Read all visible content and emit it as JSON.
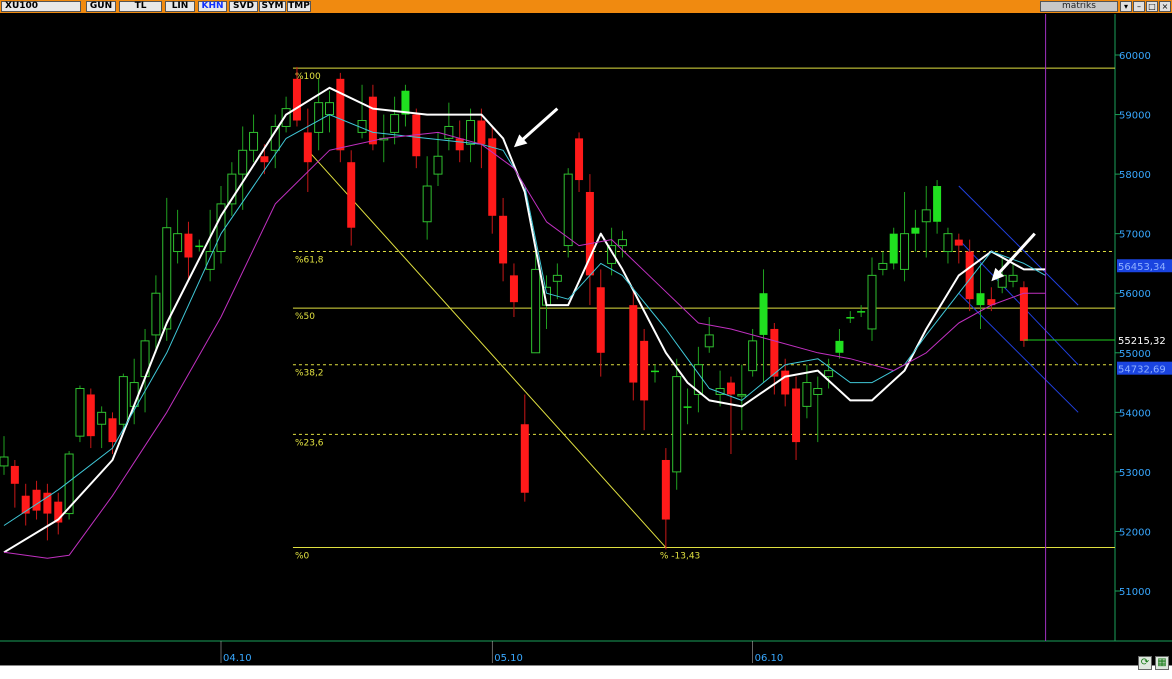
{
  "toolbar": {
    "symbol": "XU100",
    "buttons": [
      "GUN",
      "TL",
      "LIN",
      "KHN",
      "SVD",
      "SYM",
      "TMP"
    ],
    "active": "KHN",
    "brand": "matriks"
  },
  "colors": {
    "background": "#000000",
    "up_candle": "#20e020",
    "down_candle": "#ff1a1a",
    "hollow_candle": "#30c030",
    "ma_fast": "#ffffff",
    "ma_mid": "#40c8d8",
    "ma_slow": "#c030c0",
    "fibonacci": "#e0e040",
    "channel": "#2040e0",
    "axis_text": "#38a8ff",
    "price_tag": "#1a44e0"
  },
  "chart_data": {
    "type": "candlestick",
    "title": "XU100",
    "xlabel": "",
    "ylabel": "",
    "ylim": [
      50000,
      60800
    ],
    "y_ticks": [
      "60000",
      "59000",
      "58000",
      "57000",
      "56000",
      "55000",
      "54000",
      "53000",
      "52000",
      "51000"
    ],
    "x_ticks": [
      "04.10",
      "05.10",
      "06.10"
    ],
    "x_tick_index": [
      20,
      45,
      69
    ],
    "price_tags": [
      {
        "label": "56453,34",
        "value": 56453
      },
      {
        "label": "55215,32",
        "value": 55215
      },
      {
        "label": "54732,69",
        "value": 54733
      }
    ],
    "candles": [
      [
        53250,
        53100,
        53600,
        52950,
        "hollow"
      ],
      [
        53100,
        52800,
        53200,
        52400,
        "down"
      ],
      [
        52600,
        52300,
        52800,
        52100,
        "down"
      ],
      [
        52700,
        52350,
        52850,
        52200,
        "down"
      ],
      [
        52650,
        52300,
        52800,
        51850,
        "down"
      ],
      [
        52500,
        52150,
        52650,
        51950,
        "down"
      ],
      [
        52300,
        53300,
        53350,
        52200,
        "hollow"
      ],
      [
        53600,
        54400,
        54450,
        53500,
        "hollow"
      ],
      [
        54300,
        53600,
        54400,
        53400,
        "down"
      ],
      [
        53800,
        54000,
        54100,
        53400,
        "hollow"
      ],
      [
        53900,
        53500,
        54000,
        53300,
        "down"
      ],
      [
        53800,
        54600,
        54650,
        53700,
        "hollow"
      ],
      [
        54100,
        54500,
        54900,
        53800,
        "hollow"
      ],
      [
        54600,
        55200,
        55400,
        54000,
        "hollow"
      ],
      [
        55300,
        56000,
        56300,
        55000,
        "hollow"
      ],
      [
        55400,
        57100,
        57600,
        55200,
        "hollow"
      ],
      [
        56700,
        57000,
        57400,
        56500,
        "hollow"
      ],
      [
        57000,
        56600,
        57200,
        56200,
        "down"
      ],
      [
        56800,
        56800,
        56900,
        56700,
        "up"
      ],
      [
        56400,
        56700,
        57400,
        56200,
        "hollow"
      ],
      [
        56700,
        57500,
        57800,
        56500,
        "hollow"
      ],
      [
        57500,
        58000,
        58200,
        57300,
        "hollow"
      ],
      [
        58000,
        58400,
        58800,
        57400,
        "hollow"
      ],
      [
        58400,
        58700,
        59000,
        58200,
        "hollow"
      ],
      [
        58300,
        58200,
        58500,
        58000,
        "down"
      ],
      [
        58400,
        58800,
        59000,
        58100,
        "hollow"
      ],
      [
        58800,
        59100,
        59300,
        58700,
        "hollow"
      ],
      [
        59600,
        58900,
        59800,
        58800,
        "down"
      ],
      [
        58700,
        58200,
        59100,
        57700,
        "down"
      ],
      [
        58700,
        59200,
        59600,
        58400,
        "hollow"
      ],
      [
        59000,
        59200,
        59400,
        58700,
        "hollow"
      ],
      [
        59600,
        58400,
        59700,
        58200,
        "down"
      ],
      [
        58200,
        57100,
        58400,
        56800,
        "down"
      ],
      [
        58700,
        58900,
        59500,
        58600,
        "hollow"
      ],
      [
        59300,
        58500,
        59500,
        58400,
        "down"
      ],
      [
        58600,
        58600,
        59000,
        58200,
        "hollow"
      ],
      [
        58700,
        59000,
        59300,
        58500,
        "hollow"
      ],
      [
        59400,
        59000,
        59500,
        58800,
        "up"
      ],
      [
        59000,
        58300,
        59100,
        58100,
        "down"
      ],
      [
        57200,
        57800,
        58300,
        56900,
        "hollow"
      ],
      [
        58000,
        58300,
        58700,
        57800,
        "hollow"
      ],
      [
        58800,
        58600,
        59200,
        58400,
        "hollow"
      ],
      [
        58600,
        58400,
        58900,
        58200,
        "down"
      ],
      [
        58500,
        58900,
        59100,
        58200,
        "hollow"
      ],
      [
        58900,
        58500,
        59100,
        58100,
        "down"
      ],
      [
        58600,
        57300,
        58800,
        57000,
        "down"
      ],
      [
        57300,
        56500,
        57600,
        56200,
        "down"
      ],
      [
        56300,
        55850,
        56500,
        55600,
        "down"
      ],
      [
        53800,
        52650,
        54300,
        52500,
        "down"
      ],
      [
        55000,
        56400,
        56800,
        55000,
        "hollow"
      ],
      [
        55800,
        56100,
        56300,
        55400,
        "hollow"
      ],
      [
        56200,
        56300,
        56500,
        55900,
        "hollow"
      ],
      [
        56800,
        58000,
        58100,
        56600,
        "hollow"
      ],
      [
        58600,
        57900,
        58700,
        57700,
        "down"
      ],
      [
        57700,
        56300,
        58000,
        55800,
        "down"
      ],
      [
        56100,
        55000,
        56400,
        54600,
        "down"
      ],
      [
        56800,
        56500,
        57100,
        56300,
        "hollow"
      ],
      [
        56800,
        56900,
        57050,
        56600,
        "hollow"
      ],
      [
        55800,
        54500,
        56100,
        54200,
        "down"
      ],
      [
        55200,
        54200,
        55400,
        53700,
        "down"
      ],
      [
        54700,
        54700,
        54800,
        54500,
        "up"
      ],
      [
        53200,
        52200,
        53400,
        51700,
        "down"
      ],
      [
        53000,
        54600,
        54900,
        52700,
        "hollow"
      ],
      [
        54100,
        54100,
        54400,
        53800,
        "up"
      ],
      [
        54300,
        54800,
        55100,
        54000,
        "hollow"
      ],
      [
        55100,
        55300,
        55600,
        55000,
        "hollow"
      ],
      [
        54300,
        54400,
        54700,
        54100,
        "hollow"
      ],
      [
        54500,
        54300,
        54600,
        53300,
        "down"
      ],
      [
        54300,
        54300,
        54800,
        53700,
        "hollow"
      ],
      [
        54700,
        55200,
        55400,
        54600,
        "hollow"
      ],
      [
        55300,
        56000,
        56400,
        54500,
        "up"
      ],
      [
        55400,
        54600,
        55500,
        54300,
        "down"
      ],
      [
        54700,
        54300,
        54900,
        54100,
        "down"
      ],
      [
        54400,
        53500,
        54600,
        53200,
        "down"
      ],
      [
        54100,
        54500,
        54800,
        53900,
        "hollow"
      ],
      [
        54300,
        54400,
        54600,
        53500,
        "hollow"
      ],
      [
        54600,
        54700,
        54900,
        54400,
        "hollow"
      ],
      [
        55000,
        55200,
        55400,
        54900,
        "up"
      ],
      [
        55600,
        55600,
        55700,
        55500,
        "up"
      ],
      [
        55700,
        55700,
        55800,
        55600,
        "up"
      ],
      [
        55400,
        56300,
        56600,
        55200,
        "hollow"
      ],
      [
        56400,
        56500,
        56700,
        56300,
        "hollow"
      ],
      [
        56500,
        57000,
        57100,
        56400,
        "up"
      ],
      [
        56400,
        57000,
        57700,
        56200,
        "hollow"
      ],
      [
        57000,
        57100,
        57400,
        56700,
        "up"
      ],
      [
        57200,
        57400,
        57800,
        56600,
        "hollow"
      ],
      [
        57800,
        57200,
        57900,
        57000,
        "up"
      ],
      [
        57000,
        56700,
        57100,
        56500,
        "hollow"
      ],
      [
        56900,
        56800,
        57000,
        56500,
        "down"
      ],
      [
        56700,
        55900,
        56900,
        55700,
        "down"
      ],
      [
        55800,
        56000,
        56500,
        55400,
        "up"
      ],
      [
        55900,
        55800,
        56100,
        55700,
        "down"
      ],
      [
        56300,
        56100,
        56600,
        56000,
        "hollow"
      ],
      [
        56200,
        56300,
        56500,
        56100,
        "hollow"
      ],
      [
        56100,
        55200,
        56200,
        55100,
        "down"
      ]
    ],
    "series": [
      {
        "name": "",
        "color": "#ffffff",
        "width": 2,
        "points": [
          [
            0,
            51650
          ],
          [
            5,
            52200
          ],
          [
            10,
            53200
          ],
          [
            15,
            55500
          ],
          [
            20,
            57300
          ],
          [
            26,
            59000
          ],
          [
            30,
            59450
          ],
          [
            34,
            59100
          ],
          [
            39,
            59000
          ],
          [
            44,
            59000
          ],
          [
            46,
            58600
          ],
          [
            48,
            57700
          ],
          [
            50,
            55800
          ],
          [
            52,
            55800
          ],
          [
            55,
            57000
          ],
          [
            57,
            56400
          ],
          [
            61,
            55000
          ],
          [
            63,
            54500
          ],
          [
            65,
            54200
          ],
          [
            68,
            54100
          ],
          [
            72,
            54600
          ],
          [
            75,
            54700
          ],
          [
            78,
            54200
          ],
          [
            80,
            54200
          ],
          [
            83,
            54700
          ],
          [
            85,
            55400
          ],
          [
            88,
            56300
          ],
          [
            91,
            56700
          ],
          [
            94,
            56400
          ],
          [
            96,
            56400
          ]
        ]
      },
      {
        "name": "",
        "color": "#40c8d8",
        "width": 1,
        "points": [
          [
            0,
            52100
          ],
          [
            5,
            52700
          ],
          [
            10,
            53400
          ],
          [
            15,
            55000
          ],
          [
            20,
            57000
          ],
          [
            26,
            58600
          ],
          [
            30,
            59000
          ],
          [
            34,
            58700
          ],
          [
            39,
            58600
          ],
          [
            44,
            58500
          ],
          [
            46,
            58400
          ],
          [
            48,
            57800
          ],
          [
            50,
            56000
          ],
          [
            52,
            55900
          ],
          [
            55,
            56500
          ],
          [
            57,
            56300
          ],
          [
            61,
            55400
          ],
          [
            63,
            54900
          ],
          [
            65,
            54400
          ],
          [
            68,
            54200
          ],
          [
            72,
            54800
          ],
          [
            75,
            54900
          ],
          [
            78,
            54500
          ],
          [
            80,
            54500
          ],
          [
            83,
            54800
          ],
          [
            85,
            55300
          ],
          [
            88,
            56000
          ],
          [
            91,
            56700
          ],
          [
            94,
            56500
          ],
          [
            96,
            56300
          ]
        ]
      },
      {
        "name": "",
        "color": "#c030c0",
        "width": 1,
        "points": [
          [
            0,
            51650
          ],
          [
            4,
            51550
          ],
          [
            6,
            51600
          ],
          [
            10,
            52600
          ],
          [
            15,
            54000
          ],
          [
            20,
            55600
          ],
          [
            25,
            57500
          ],
          [
            30,
            58400
          ],
          [
            35,
            58600
          ],
          [
            40,
            58700
          ],
          [
            44,
            58500
          ],
          [
            47,
            58100
          ],
          [
            50,
            57200
          ],
          [
            53,
            56800
          ],
          [
            56,
            56900
          ],
          [
            60,
            56200
          ],
          [
            64,
            55500
          ],
          [
            67,
            55400
          ],
          [
            71,
            55200
          ],
          [
            75,
            55000
          ],
          [
            78,
            54900
          ],
          [
            82,
            54700
          ],
          [
            85,
            55000
          ],
          [
            88,
            55500
          ],
          [
            91,
            55800
          ],
          [
            94,
            56000
          ],
          [
            96,
            56000
          ]
        ]
      }
    ],
    "fibonacci": {
      "levels": [
        {
          "label": "%100",
          "value": 59780,
          "style": "solid"
        },
        {
          "label": "%61,8",
          "value": 56700,
          "style": "dashed"
        },
        {
          "label": "%50",
          "value": 55750,
          "style": "solid"
        },
        {
          "label": "%38,2",
          "value": 54800,
          "style": "dashed"
        },
        {
          "label": "%23,6",
          "value": 53630,
          "style": "dashed"
        },
        {
          "label": "%0",
          "value": 51730,
          "style": "solid"
        }
      ],
      "start_index": 27,
      "diagonal": {
        "from": [
          28,
          58400
        ],
        "to": [
          61,
          51730
        ]
      },
      "annotation": "% -13,43",
      "annotation_index": 61
    },
    "channel": {
      "start_index": 88,
      "end_index": 99,
      "top": [
        57800,
        55800
      ],
      "middle": [
        56900,
        54800
      ],
      "bottom": [
        56000,
        54000
      ]
    },
    "arrows": [
      {
        "from": [
          51,
          59100
        ],
        "to": [
          47,
          58450
        ]
      },
      {
        "from": [
          95,
          57000
        ],
        "to": [
          91,
          56200
        ]
      }
    ],
    "current_price": 55215.32,
    "cursor_index": 96
  }
}
